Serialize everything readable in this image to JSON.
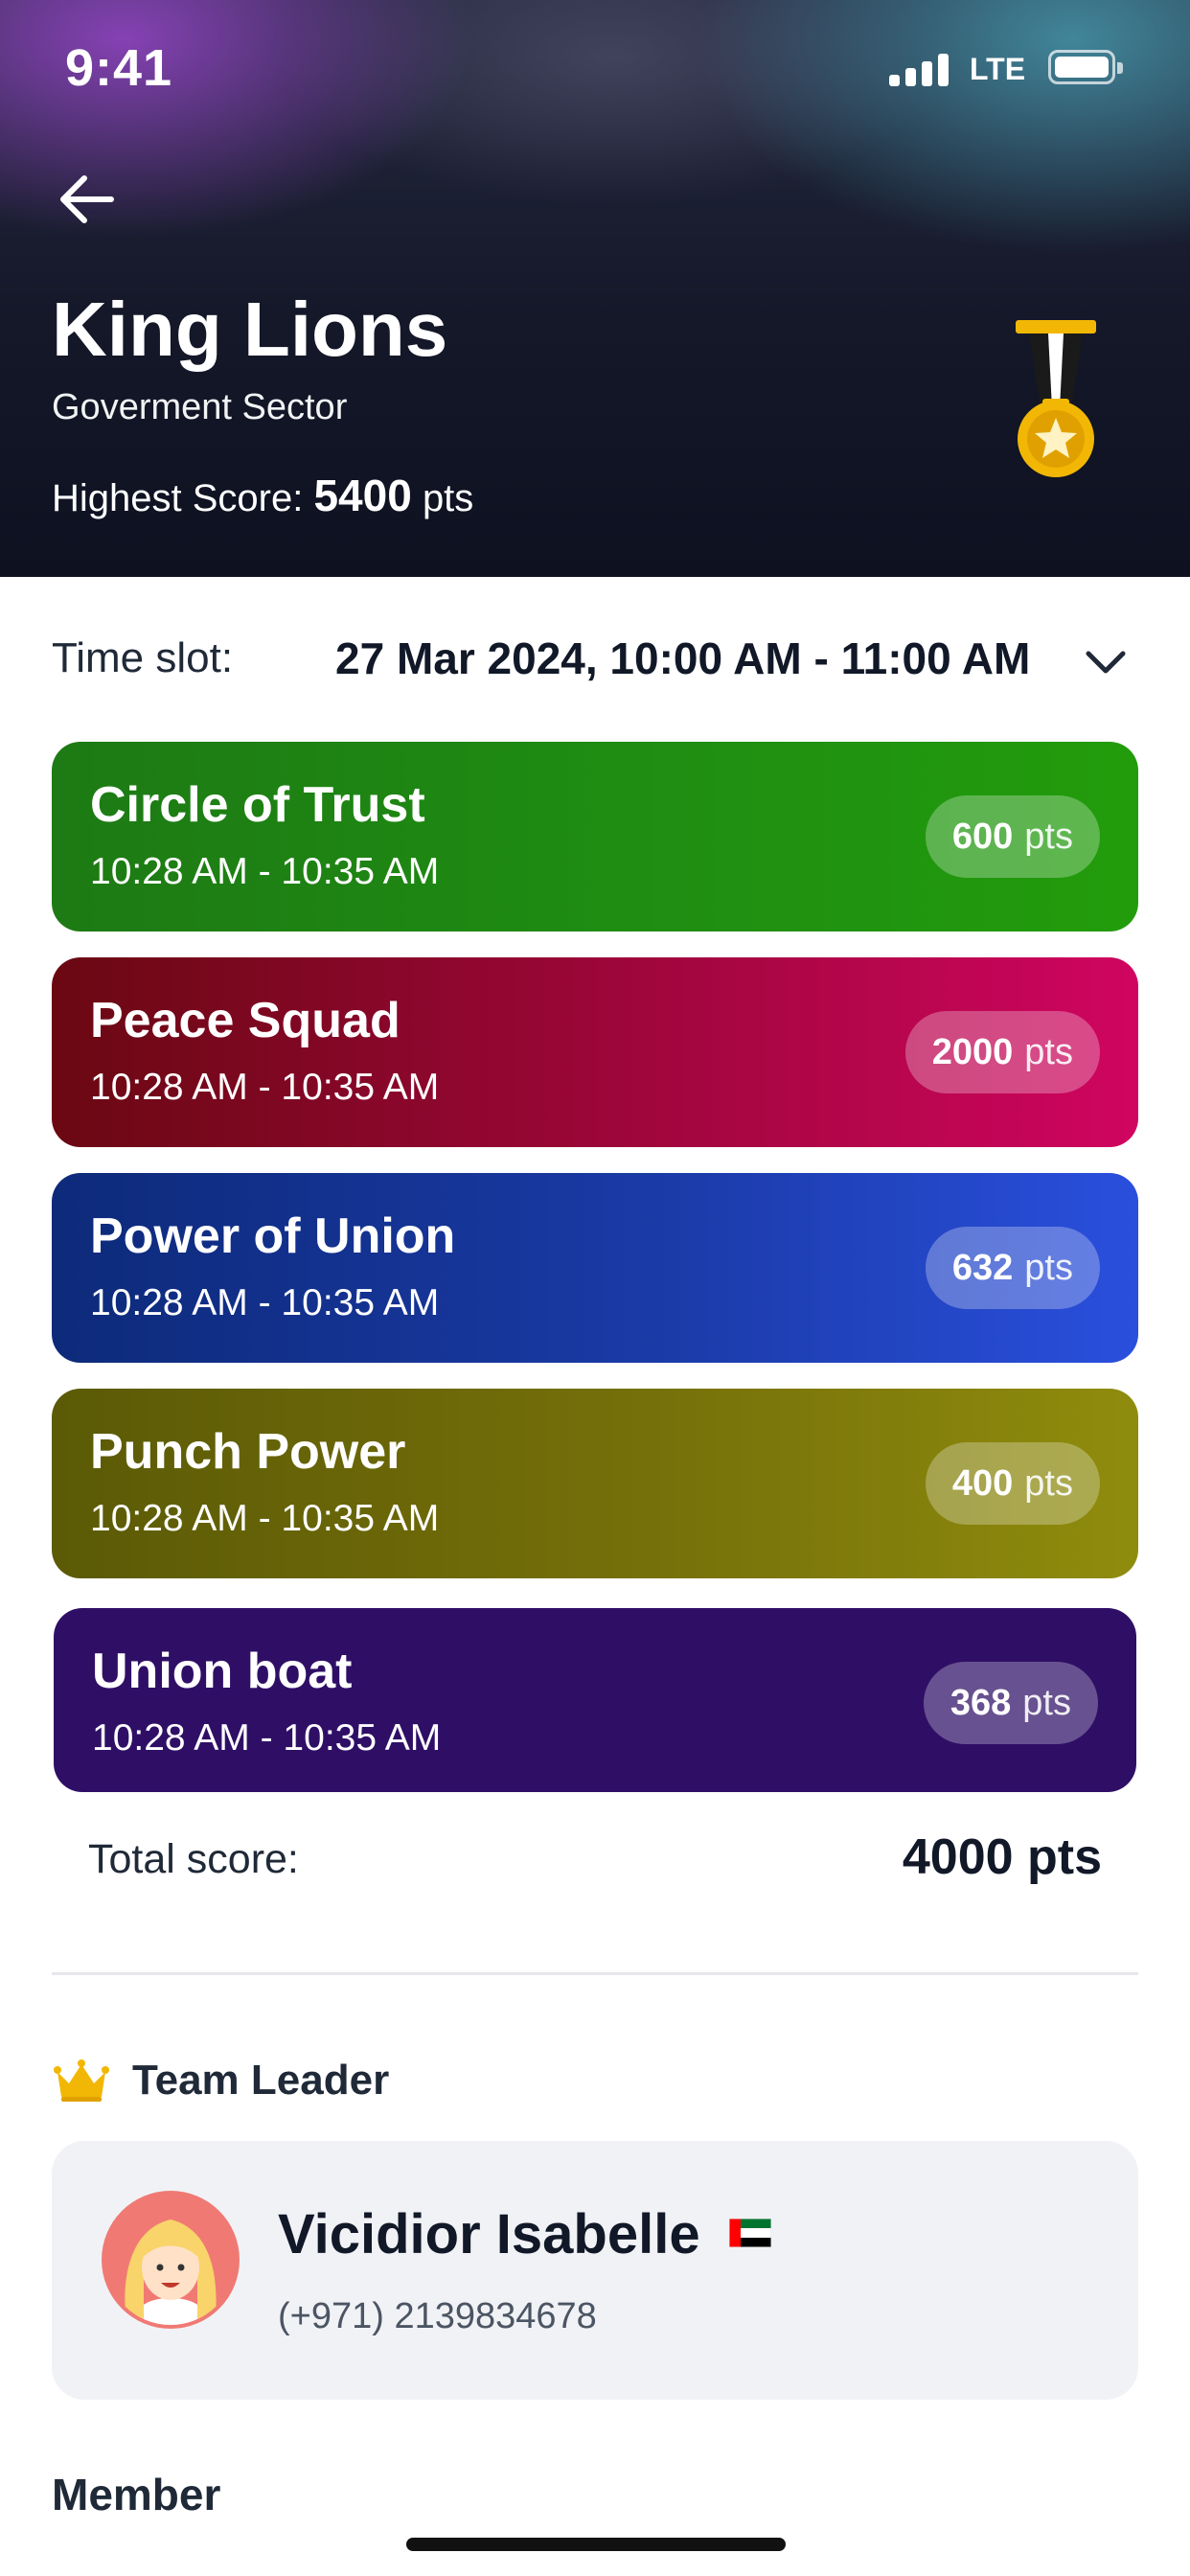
{
  "status_bar": {
    "time": "9:41",
    "network": "LTE"
  },
  "header": {
    "title": "King Lions",
    "subtitle": "Goverment Sector",
    "highest_label": "Highest Score:",
    "highest_value": "5400",
    "highest_unit": "pts",
    "badge_icon": "medal-icon"
  },
  "time_slot": {
    "label": "Time slot:",
    "value": "27 Mar 2024, 10:00 AM - 11:00 AM"
  },
  "cards": [
    {
      "name": "Circle of Trust",
      "time": "10:28 AM - 10:35 AM",
      "points": "600",
      "unit": "pts",
      "color": "#1f8f12"
    },
    {
      "name": "Peace Squad",
      "time": "10:28 AM - 10:35 AM",
      "points": "2000",
      "unit": "pts",
      "color": "#b0054a"
    },
    {
      "name": "Power of Union",
      "time": "10:28 AM - 10:35 AM",
      "points": "632",
      "unit": "pts",
      "color": "#1a3aa6"
    },
    {
      "name": "Punch Power",
      "time": "10:28 AM - 10:35 AM",
      "points": "400",
      "unit": "pts",
      "color": "#76700a"
    },
    {
      "name": "Union boat",
      "time": "10:28 AM - 10:35 AM",
      "points": "368",
      "unit": "pts",
      "color": "#2f0f66"
    }
  ],
  "total": {
    "label": "Total score:",
    "value": "4000 pts"
  },
  "leader": {
    "section_title": "Team Leader",
    "name": "Vicidior Isabelle",
    "phone": "(+971) 2139834678",
    "flag_icon": "uae-flag-icon"
  },
  "member": {
    "section_title": "Member"
  }
}
